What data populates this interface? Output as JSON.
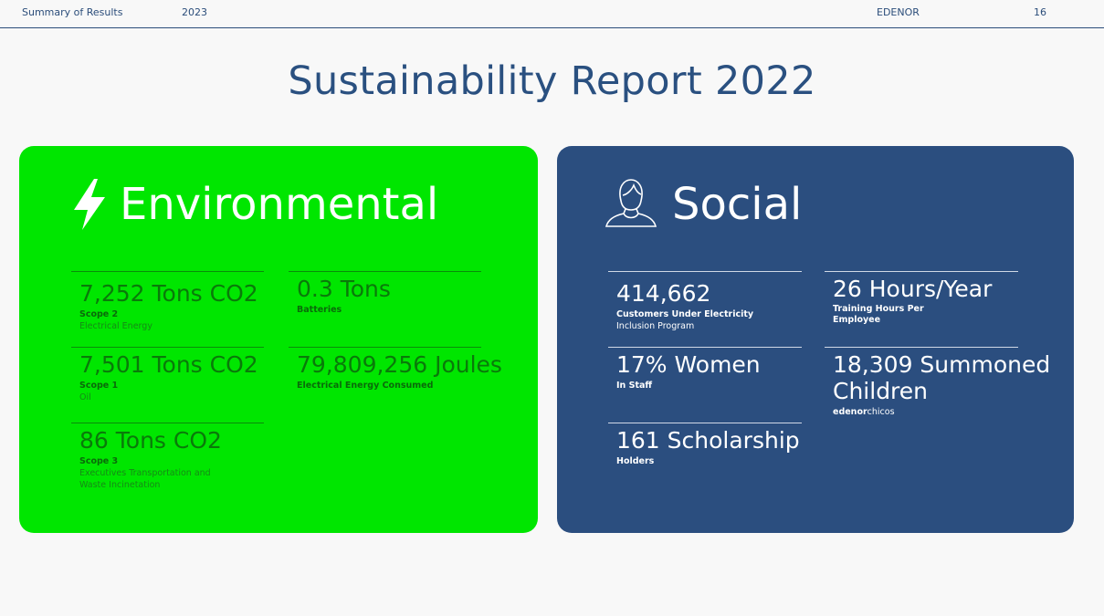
{
  "header": {
    "section": "Summary of Results",
    "year": "2023",
    "company": "EDENOR",
    "page": "16"
  },
  "title": "Sustainability Report 2022",
  "environmental": {
    "heading": "Environmental",
    "icon": "lightning-bolt-icon",
    "stats": [
      {
        "value": "7,252 Tons CO2",
        "label": "Scope 2",
        "sub": "Electrical Energy"
      },
      {
        "value": "0.3 Tons",
        "label": "Batteries"
      },
      {
        "value": "7,501 Tons CO2",
        "label": "Scope 1",
        "sub": "Oil"
      },
      {
        "value": "79,809,256 Joules",
        "label": "Electrical Energy Consumed"
      },
      {
        "value": "86 Tons CO2",
        "label": "Scope 3",
        "sub1": "Executives Transportation and",
        "sub2": "Waste Incinetation"
      }
    ]
  },
  "social": {
    "heading": "Social",
    "icon": "person-icon",
    "stats": [
      {
        "value": "414,662",
        "label": "Customers Under Electricity",
        "sub": "Inclusion Program"
      },
      {
        "value": "26 Hours/Year",
        "label1": "Training Hours Per",
        "label2": "Employee"
      },
      {
        "value": "17% Women",
        "label": "In Staff"
      },
      {
        "value1": "18,309 Summoned",
        "value2": "Children",
        "brand_bold": "edenor",
        "brand_light": "chicos"
      },
      {
        "value": "161 Scholarship",
        "label": "Holders"
      }
    ]
  },
  "colors": {
    "environmental_bg": "#00e600",
    "social_bg": "#2b4e7f",
    "title": "#2a5080"
  }
}
